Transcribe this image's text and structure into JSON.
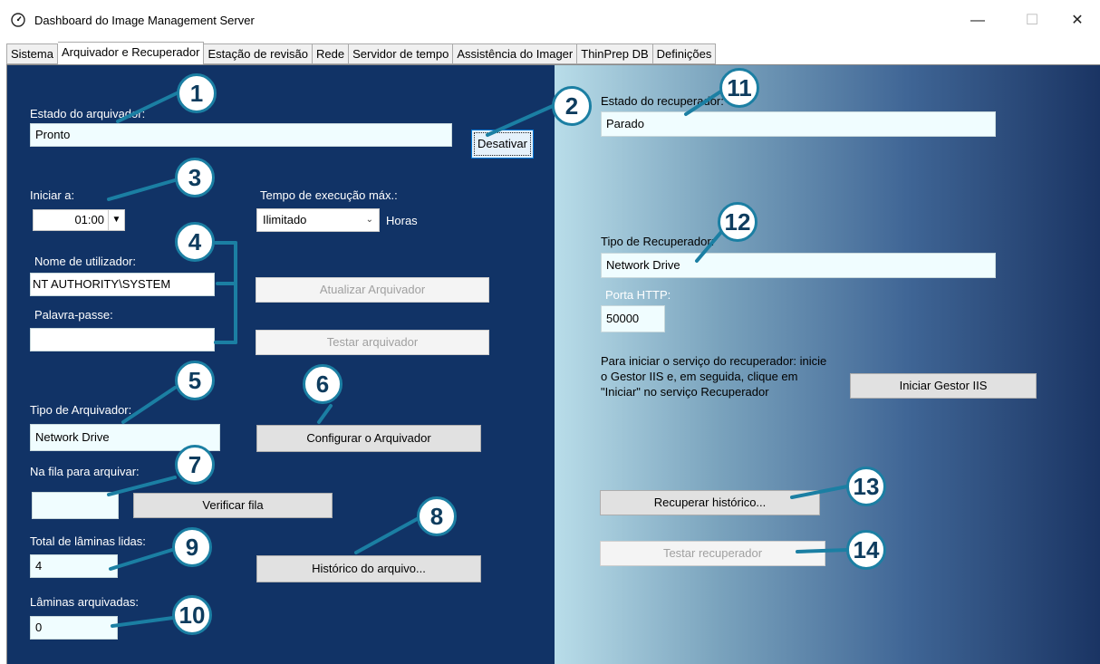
{
  "window": {
    "title": "Dashboard do Image Management Server",
    "minimize": "—",
    "maximize": "☐",
    "close": "✕"
  },
  "tabs": [
    {
      "label": "Sistema"
    },
    {
      "label": "Arquivador e Recuperador"
    },
    {
      "label": "Estação de revisão"
    },
    {
      "label": "Rede"
    },
    {
      "label": "Servidor de tempo"
    },
    {
      "label": "Assistência do Imager"
    },
    {
      "label": "ThinPrep DB"
    },
    {
      "label": "Definições"
    }
  ],
  "archiver": {
    "state_label": "Estado do arquivador:",
    "state_value": "Pronto",
    "deactivate_button": "Desativar",
    "start_label": "Iniciar a:",
    "start_time": "01:00",
    "max_runtime_label": "Tempo de execução máx.:",
    "max_runtime_value": "Ilimitado",
    "hours_label": "Horas",
    "username_label": "Nome de utilizador:",
    "username_value": "NT AUTHORITY\\SYSTEM",
    "password_label": "Palavra-passe:",
    "password_value": "",
    "update_button": "Atualizar Arquivador",
    "test_button": "Testar arquivador",
    "type_label": "Tipo de Arquivador:",
    "type_value": "Network Drive",
    "configure_button": "Configurar o Arquivador",
    "queue_label": "Na fila para arquivar:",
    "queue_value": "",
    "check_queue_button": "Verificar fila",
    "total_read_label": "Total de lâminas lidas:",
    "total_read_value": "4",
    "history_button": "Histórico do arquivo...",
    "archived_label": "Lâminas arquivadas:",
    "archived_value": "0"
  },
  "retriever": {
    "state_label": "Estado do recuperador:",
    "state_value": "Parado",
    "type_label": "Tipo de Recuperador:",
    "type_value": "Network Drive",
    "http_port_label": "Porta HTTP:",
    "http_port_value": "50000",
    "instructions": "Para iniciar o serviço do recuperador: inicie o Gestor IIS e, em seguida, clique em \"Iniciar\" no serviço Recuperador",
    "start_iis_button": "Iniciar Gestor IIS",
    "history_button": "Recuperar histórico...",
    "test_button": "Testar recuperador"
  },
  "callouts": [
    "1",
    "2",
    "3",
    "4",
    "5",
    "6",
    "7",
    "8",
    "9",
    "10",
    "11",
    "12",
    "13",
    "14"
  ],
  "colors": {
    "left_panel": "#113366",
    "callout_line": "#1b7fa3",
    "field_bg": "#f0fdff"
  }
}
